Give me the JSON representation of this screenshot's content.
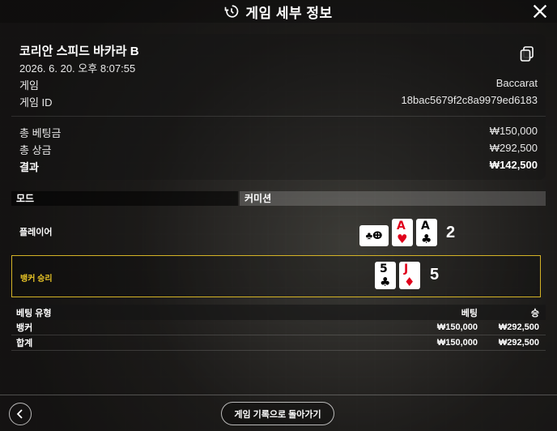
{
  "header": {
    "title": "게임 세부 정보",
    "icon": "history-clock-icon",
    "close_icon": "close-icon"
  },
  "game": {
    "name": "코리안 스피드 바카라 B",
    "datetime": "2026. 6. 20. 오후 8:07:55",
    "game_label": "게임",
    "game_value": "Baccarat",
    "id_label": "게임 ID",
    "id_value": "18bac5679f2c8a9979ed6183"
  },
  "totals": {
    "bet_label": "총 베팅금",
    "bet_value": "₩150,000",
    "win_label": "총 상금",
    "win_value": "₩292,500",
    "result_label": "결과",
    "result_value": "₩142,500"
  },
  "modebar": {
    "mode": "모드",
    "commission": "커미션"
  },
  "player": {
    "label": "플레이어",
    "cards": [
      {
        "rank": "A",
        "suit": "♥",
        "color": "red"
      },
      {
        "rank": "A",
        "suit": "♣",
        "color": "black"
      }
    ],
    "score": "2"
  },
  "banker": {
    "label": "뱅커 승리",
    "cards": [
      {
        "rank": "5",
        "suit": "♣",
        "color": "black"
      },
      {
        "rank": "J",
        "suit": "♦",
        "color": "red"
      }
    ],
    "score": "5"
  },
  "bets": {
    "headers": {
      "type": "베팅 유형",
      "bet": "베팅",
      "win": "승"
    },
    "rows": [
      {
        "type": "뱅커",
        "bet": "₩150,000",
        "win": "₩292,500"
      },
      {
        "type": "합계",
        "bet": "₩150,000",
        "win": "₩292,500"
      }
    ]
  },
  "footer": {
    "history_button": "게임 기록으로 돌아가기",
    "back_icon": "chevron-left-icon"
  },
  "colors": {
    "highlight": "#d4b326",
    "red_suit": "#e0001b"
  }
}
